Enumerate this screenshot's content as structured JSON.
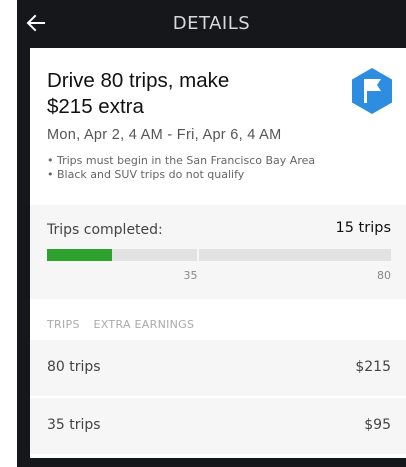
{
  "header": {
    "title": "DETAILS",
    "back_icon": "arrow-left-icon"
  },
  "promo": {
    "headline_line1": "Drive 80 trips, make",
    "headline_line2": "$215 extra",
    "dates": "Mon, Apr 2, 4 AM - Fri, Apr 6, 4 AM",
    "rules": [
      "• Trips must begin in the San Francisco Bay Area",
      "• Black and SUV trips do not qualify"
    ],
    "badge_icon": "flag-icon",
    "badge_color": "#2d8de0"
  },
  "progress": {
    "label": "Trips completed:",
    "count_text": "15 trips",
    "completed": 15,
    "max": 80,
    "fill_color": "#2ea12e",
    "milestones": [
      35,
      80
    ]
  },
  "table": {
    "headers": [
      "TRIPS",
      "EXTRA EARNINGS"
    ],
    "rows": [
      {
        "trips": "80 trips",
        "earnings": "$215"
      },
      {
        "trips": "35 trips",
        "earnings": "$95"
      }
    ]
  }
}
